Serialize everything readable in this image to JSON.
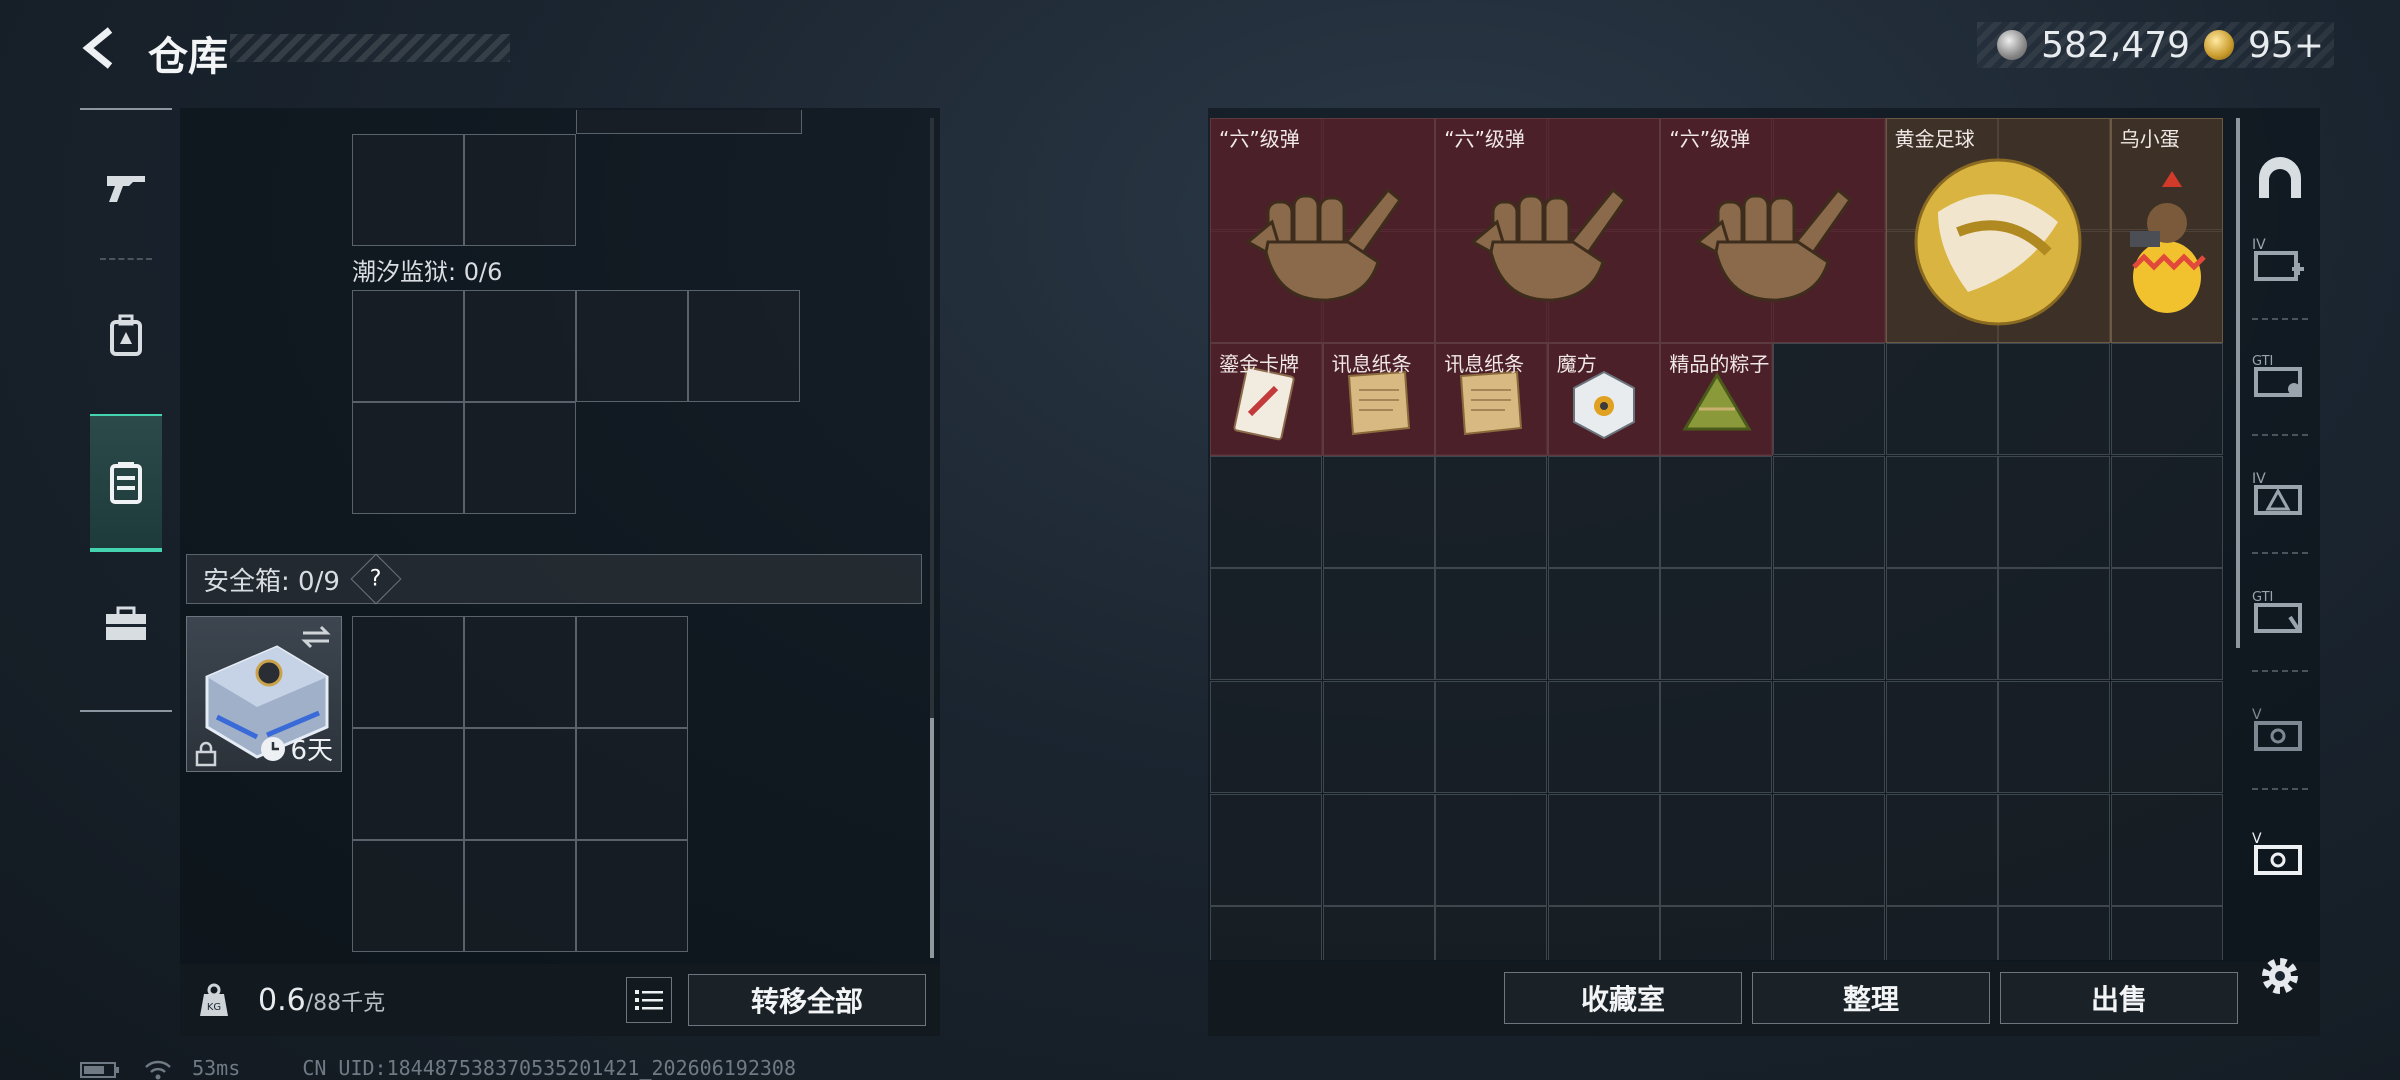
{
  "header": {
    "title": "仓库"
  },
  "currency": {
    "silver_value": "582,479",
    "gold_value": "95+"
  },
  "left_nav": {
    "items": [
      {
        "icon": "gun-icon"
      },
      {
        "icon": "backpack-icon"
      },
      {
        "icon": "storage-container-icon",
        "active": true
      },
      {
        "icon": "toolbox-icon"
      }
    ]
  },
  "left_panel": {
    "section_label": "潮汐监狱: 0/6",
    "safe_box": {
      "label": "安全箱: 0/9",
      "help": "?",
      "timer": "6天"
    }
  },
  "bottom_left": {
    "weight_value": "0.6",
    "weight_max": "/88千克",
    "transfer_all": "转移全部"
  },
  "stash_items": [
    {
      "name": "“六”级弹",
      "icon": "hand-gesture-icon"
    },
    {
      "name": "“六”级弹",
      "icon": "hand-gesture-icon"
    },
    {
      "name": "“六”级弹",
      "icon": "hand-gesture-icon"
    },
    {
      "name": "黄金足球",
      "icon": "gold-football-icon"
    },
    {
      "name": "乌小蛋",
      "icon": "egg-figure-icon"
    },
    {
      "name": "鎏金卡牌",
      "icon": "card-icon"
    },
    {
      "name": "讯息纸条",
      "icon": "paper-note-icon"
    },
    {
      "name": "讯息纸条",
      "icon": "paper-note-icon"
    },
    {
      "name": "魔方",
      "icon": "cube-icon"
    },
    {
      "name": "精品的粽子",
      "icon": "zongzi-icon"
    }
  ],
  "bottom_right": {
    "collection_room": "收藏室",
    "organize": "整理",
    "sell": "出售"
  },
  "status_bar": {
    "ping": "53ms",
    "uid": "CN UID:1844875383705352014​21_202606192308"
  }
}
